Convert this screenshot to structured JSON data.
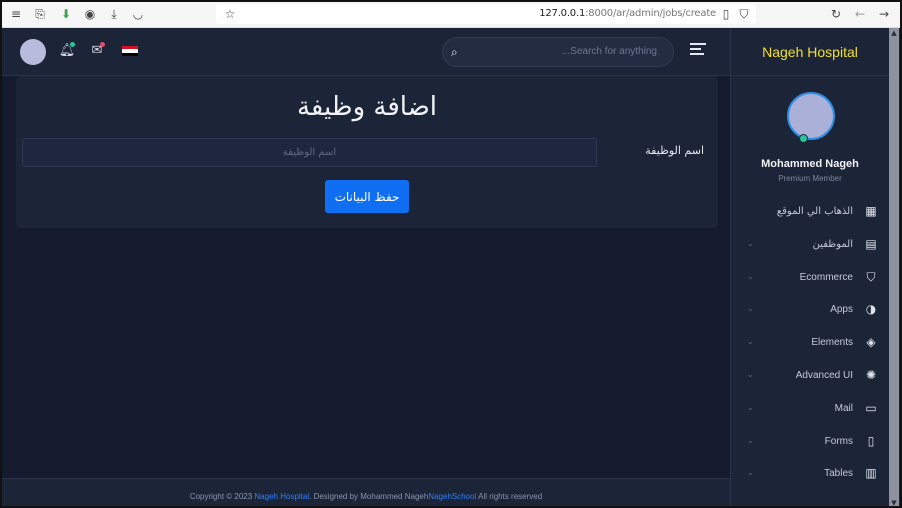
{
  "browser": {
    "url_host": "127.0.0.1",
    "url_path": ":8000/ar/admin/jobs/create",
    "icons": [
      "menu-icon",
      "extensions-icon",
      "download-arrow-icon",
      "account-icon",
      "downloads-icon",
      "pocket-icon",
      "bookmark-star-icon",
      "reader-icon",
      "shield-icon",
      "reload-icon",
      "back-icon",
      "forward-icon"
    ]
  },
  "topnav": {
    "search_placeholder": "...Search for anything",
    "flag_colors": [
      "#ce1126",
      "#ffffff",
      "#000000"
    ],
    "notification_dot_color": "#20c997",
    "mail_dot_color": "#e44b6c"
  },
  "form": {
    "title": "اضافة وظيفة",
    "field_label": "اسم الوظيفة",
    "field_placeholder": "اسم الوظيفة",
    "field_value": "",
    "submit_label": "حفظ البيانات"
  },
  "footer": {
    "prefix": "Copyright © 2023 ",
    "brand": "Nageh Hospital",
    "middle": ". Designed by Mohammed Nageh",
    "school": "NagehSchool",
    "suffix": " All rights reserved"
  },
  "sidebar": {
    "brand": "Nageh Hospital",
    "brand_color": "#f1e02f",
    "user_name": "Mohammed Nageh",
    "user_role": "Premium Member",
    "items": [
      {
        "label": "الذهاب الي الموقع",
        "icon": "dashboard-icon",
        "glyph": "▦",
        "has_chevron": false
      },
      {
        "label": "الموظفين",
        "icon": "chart-icon",
        "glyph": "▤",
        "has_chevron": true
      },
      {
        "label": "Ecommerce",
        "icon": "basket-icon",
        "glyph": "⛉",
        "has_chevron": true
      },
      {
        "label": "Apps",
        "icon": "pie-icon",
        "glyph": "◑",
        "has_chevron": true
      },
      {
        "label": "Elements",
        "icon": "layers-icon",
        "glyph": "◈",
        "has_chevron": true
      },
      {
        "label": "Advanced UI",
        "icon": "palette-icon",
        "glyph": "✺",
        "has_chevron": true
      },
      {
        "label": "Mail",
        "icon": "chat-icon",
        "glyph": "▭",
        "has_chevron": true
      },
      {
        "label": "Forms",
        "icon": "document-icon",
        "glyph": "▯",
        "has_chevron": true
      },
      {
        "label": "Tables",
        "icon": "table-icon",
        "glyph": "▥",
        "has_chevron": true
      }
    ]
  }
}
